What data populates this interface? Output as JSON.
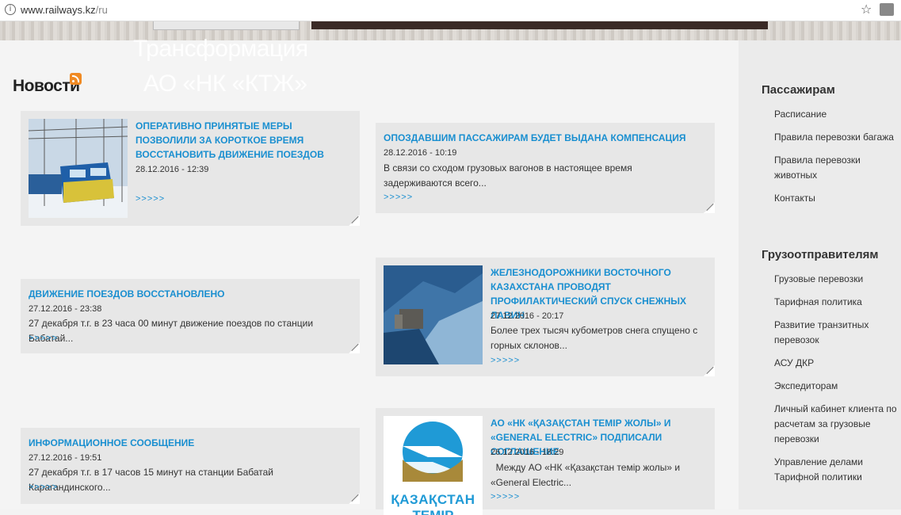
{
  "browser": {
    "url_host": "www.railways.kz",
    "url_path": "/ru"
  },
  "overlay": {
    "line1": "Трансформация",
    "line2": "АО «НК «КТЖ»"
  },
  "news": {
    "heading": "Новости",
    "more_label": ">>>>>",
    "items": [
      {
        "title": "Оперативно принятые меры позволили за короткое время восстановить движение поездов",
        "date": "28.12.2016 - 12:39",
        "text": ""
      },
      {
        "title": "Опоздавшим пассажирам будет выдана компенсация",
        "date": "28.12.2016 - 10:19",
        "text": "В связи со сходом грузовых вагонов в настоящее время задерживаются всего..."
      },
      {
        "title": "Движение поездов восстановлено",
        "date": "27.12.2016 - 23:38",
        "text": "27 декабря т.г. в 23 часа 00 минут движение поездов по станции Бабатай..."
      },
      {
        "title": "Железнодорожники Восточного Казахстана проводят профилактический спуск снежных лавин",
        "date": "27.12.2016 - 20:17",
        "text": "Более трех тысяч  кубометров снега спущено с горных склонов..."
      },
      {
        "title": "Информационное сообщение",
        "date": "27.12.2016 - 19:51",
        "text": "27 декабря т.г. в 17 часов 15 минут на станции Бабатай Карагандинского..."
      },
      {
        "title": "АО «НК «Қазақстан темір жолы» и «General Electric» подписали соглашение",
        "date": "26.12.2016 - 18:29",
        "text": "  Между АО «НК «Қазақстан темір жолы» и «General Electric..."
      }
    ],
    "logo_text_1": "ҚАЗАҚСТАН",
    "logo_text_2": "ТЕМІР"
  },
  "sidebar": {
    "passengers": {
      "heading": "Пассажирам",
      "links": [
        "Расписание",
        "Правила перевозки багажа",
        "Правила перевозки животных",
        "Контакты"
      ]
    },
    "shippers": {
      "heading": "Грузоотправителям",
      "links": [
        "Грузовые перевозки",
        "Тарифная политика",
        "Развитие транзитных перевозок",
        "АСУ ДКР",
        "Экспедиторам",
        "Личный кабинет клиента по расчетам за грузовые перевозки",
        "Управление делами Тарифной политики"
      ]
    }
  },
  "colors": {
    "link_blue": "#1a8fd0",
    "card_bg": "#e7e7e7",
    "logo_blue": "#1f9ad6",
    "logo_gold": "#a8893a"
  }
}
